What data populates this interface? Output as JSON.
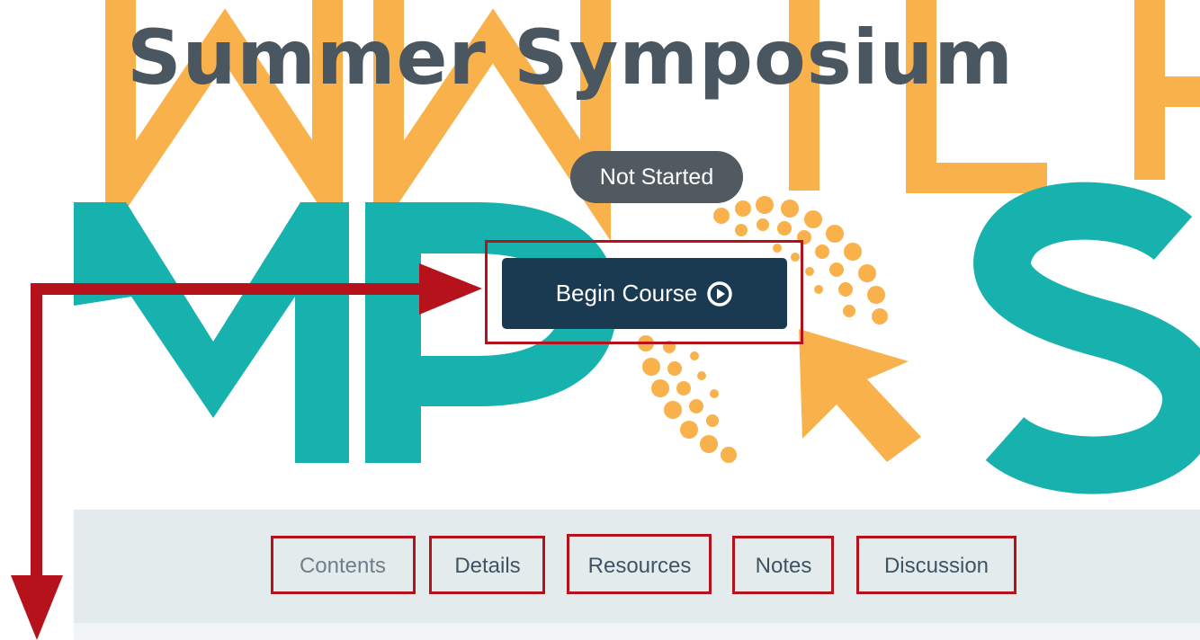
{
  "course": {
    "title": "Summer Symposium",
    "status": "Not Started",
    "begin_button": {
      "label": "Begin Course",
      "icon": "play-circle-icon"
    }
  },
  "tabs": [
    {
      "label": "Contents"
    },
    {
      "label": "Details"
    },
    {
      "label": "Resources"
    },
    {
      "label": "Notes"
    },
    {
      "label": "Discussion"
    }
  ],
  "colors": {
    "title": "#4a5660",
    "status_badge": "#505a60",
    "begin_button": "#1a3a52",
    "tab_bar": "#e4ebec",
    "hero_orange": "#f8b14b",
    "hero_teal": "#17b1ae",
    "annotation_red": "#b5121b"
  }
}
